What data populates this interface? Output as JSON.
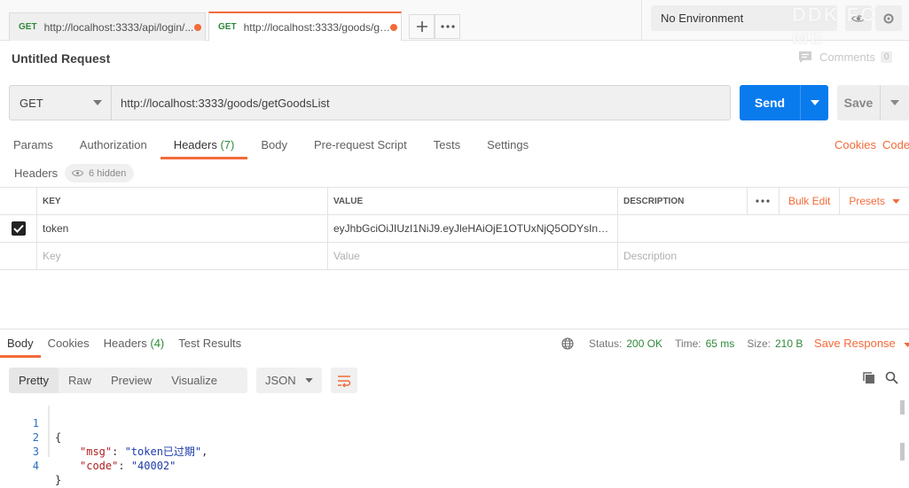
{
  "tabs": [
    {
      "method": "GET",
      "url": "http://localhost:3333/api/login/..."
    },
    {
      "method": "GET",
      "url": "http://localhost:3333/goods/get..."
    }
  ],
  "environment": "No Environment",
  "watermark": "DDK FC ME",
  "request": {
    "title": "Untitled Request",
    "comments_label": "Comments",
    "comments_count": "0",
    "method": "GET",
    "url": "http://localhost:3333/goods/getGoodsList",
    "send_label": "Send",
    "save_label": "Save"
  },
  "subtabs": {
    "params": "Params",
    "authorization": "Authorization",
    "headers": "Headers",
    "headers_count": "(7)",
    "body": "Body",
    "prerequest": "Pre-request Script",
    "tests": "Tests",
    "settings": "Settings",
    "cookies": "Cookies",
    "code": "Code"
  },
  "headers_section": {
    "label": "Headers",
    "hidden": "6 hidden",
    "columns": {
      "key": "KEY",
      "value": "VALUE",
      "description": "DESCRIPTION"
    },
    "bulk_edit": "Bulk Edit",
    "presets": "Presets",
    "rows": [
      {
        "key": "token",
        "value": "eyJhbGciOiJIUzI1NiJ9.eyJleHAiOjE1OTUxNjQ5ODYsInVz..."
      }
    ],
    "placeholders": {
      "key": "Key",
      "value": "Value",
      "description": "Description"
    }
  },
  "response": {
    "tabs": {
      "body": "Body",
      "cookies": "Cookies",
      "headers": "Headers",
      "headers_count": "(4)",
      "test_results": "Test Results"
    },
    "status_label": "Status:",
    "status": "200 OK",
    "time_label": "Time:",
    "time": "65 ms",
    "size_label": "Size:",
    "size": "210 B",
    "save_response": "Save Response",
    "view_modes": [
      "Pretty",
      "Raw",
      "Preview",
      "Visualize"
    ],
    "format": "JSON",
    "lines": [
      {
        "num": "1",
        "text": "{"
      },
      {
        "num": "2",
        "key": "\"msg\"",
        "value": "\"token已过期\"",
        "trail": ","
      },
      {
        "num": "3",
        "key": "\"code\"",
        "value": "\"40002\"",
        "trail": ""
      },
      {
        "num": "4",
        "text": "}"
      }
    ]
  }
}
